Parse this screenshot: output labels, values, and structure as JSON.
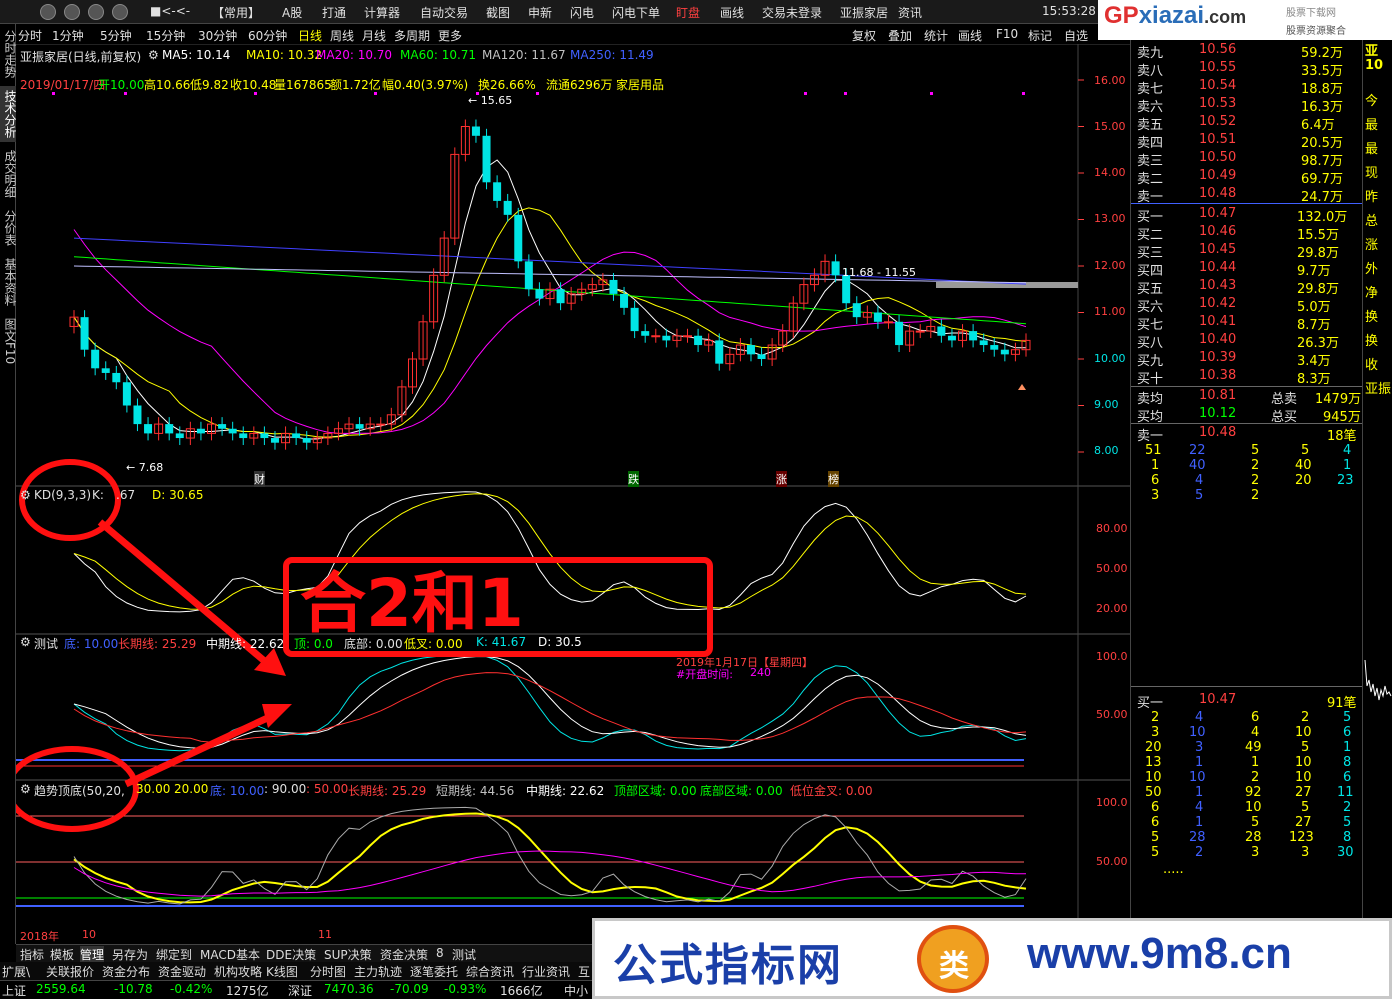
{
  "topbar": {
    "menus": [
      "【常用】",
      "A股",
      "打通",
      "计算器",
      "自动交易",
      "截图",
      "申新",
      "闪电",
      "闪电下单",
      "盯盘",
      "画线",
      "交易未登录",
      "亚振家居",
      "资讯"
    ],
    "time": "15:53:28"
  },
  "logo": {
    "gp": "GP",
    "rest": "xiazai",
    "dot": ".com",
    "sub1": "股票下载网",
    "sub2": "股票资源聚合"
  },
  "sidebar": [
    "分时走势",
    "技术分析",
    "成交明细",
    "分价表",
    "基本资料",
    "图文F10"
  ],
  "periods": [
    "分时",
    "1分钟",
    "5分钟",
    "15分钟",
    "30分钟",
    "60分钟",
    "日线",
    "周线",
    "月线",
    "多周期",
    "更多"
  ],
  "tools": [
    "复权",
    "叠加",
    "统计",
    "画线",
    "F10",
    "标记",
    "自选"
  ],
  "stock": {
    "name": "亚振家居(日线,前复权)",
    "ma5": "MA5: 10.14",
    "ma10": "MA10: 10.32",
    "ma20": "MA20: 10.70",
    "ma60": "MA60: 10.71",
    "ma120": "MA120: 11.67",
    "ma250": "MA250: 11.49"
  },
  "info": {
    "date": "2019/01/17/四",
    "open": "开10.00",
    "high": "高10.66",
    "low": "低9.82",
    "close": "收10.48",
    "vol": "量167865",
    "amt": "额1.72亿",
    "chg": "幅0.40(3.97%)",
    "turn": "换26.66%",
    "float": "流通6296万",
    "industry": "家居用品"
  },
  "annot": {
    "hi": "15.65",
    "lo": "7.68",
    "band": "11.68 - 11.55",
    "cai": "财",
    "die": "跌",
    "zhang": "涨",
    "bang": "榜"
  },
  "y_price": [
    "16.00",
    "15.00",
    "14.00",
    "13.00",
    "12.00",
    "11.00",
    "10.00",
    "9.00",
    "8.00"
  ],
  "kd": {
    "title": "KD(9,3,3)",
    "k": "K:",
    "kv": ".67",
    "d": "D: 30.65",
    "ticks": [
      "80.00",
      "50.00",
      "20.00"
    ]
  },
  "test": {
    "title": "测试",
    "di": "底: 10.00",
    "chang": "长期线: 25.29",
    "zhong": "中期线: 22.62",
    "ding": "顶: 0.0",
    "dibu": "底部: 0.00",
    "dicha": "低叉: 0.00",
    "k": "K: 41.67",
    "d": "D: 30.5",
    "ticks": [
      "100.0",
      "50.00"
    ],
    "datelbl": "2019年1月17日【星期四】",
    "opentime": "#开盘时间:",
    "openval": "240"
  },
  "trend": {
    "title": "趋势顶底(50,20,",
    "p2": "30.00",
    "p3": "20.00",
    "di": "底: 10.00",
    "p90": ": 90.00",
    "p50": ": 50.00",
    "chang": "长期线: 25.29",
    "duan": "短期线: 44.56",
    "zhong": "中期线: 22.62",
    "dingqu": "顶部区域: 0.00",
    "diqu": "底部区域: 0.00",
    "jincha": "低位金叉: 0.00",
    "ticks": [
      "100.0",
      "50.00"
    ]
  },
  "xaxis": {
    "y2018": "2018年",
    "m10": "10",
    "m11": "11"
  },
  "overlay": {
    "text": "合2和1"
  },
  "orderbook": {
    "sell": [
      [
        "卖九",
        "10.56",
        "59.2万"
      ],
      [
        "卖八",
        "10.55",
        "33.5万"
      ],
      [
        "卖七",
        "10.54",
        "18.8万"
      ],
      [
        "卖六",
        "10.53",
        "16.3万"
      ],
      [
        "卖五",
        "10.52",
        "6.4万"
      ],
      [
        "卖四",
        "10.51",
        "20.5万"
      ],
      [
        "卖三",
        "10.50",
        "98.7万"
      ],
      [
        "卖二",
        "10.49",
        "69.7万"
      ],
      [
        "卖一",
        "10.48",
        "24.7万"
      ]
    ],
    "buy": [
      [
        "买一",
        "10.47",
        "132.0万"
      ],
      [
        "买二",
        "10.46",
        "15.5万"
      ],
      [
        "买三",
        "10.45",
        "29.8万"
      ],
      [
        "买四",
        "10.44",
        "9.7万"
      ],
      [
        "买五",
        "10.43",
        "29.8万"
      ],
      [
        "买六",
        "10.42",
        "5.0万"
      ],
      [
        "买七",
        "10.41",
        "8.7万"
      ],
      [
        "买八",
        "10.40",
        "26.3万"
      ],
      [
        "买九",
        "10.39",
        "3.4万"
      ],
      [
        "买十",
        "10.38",
        "8.3万"
      ]
    ],
    "avg_sell": [
      "卖均",
      "10.81",
      "总卖",
      "1479万"
    ],
    "avg_buy": [
      "买均",
      "10.12",
      "总买",
      "945万"
    ],
    "sell1_line": [
      "卖一",
      "10.48",
      "18笔"
    ],
    "sell1_rows": [
      [
        "51",
        "22",
        "5",
        "5",
        "4"
      ],
      [
        "1",
        "40",
        "2",
        "40",
        "1"
      ],
      [
        "6",
        "4",
        "2",
        "20",
        "23"
      ],
      [
        "3",
        "5",
        "2",
        "",
        ""
      ]
    ],
    "buy1_line": [
      "买一",
      "10.47",
      "91笔"
    ],
    "buy1_rows": [
      [
        "2",
        "4",
        "6",
        "2",
        "5"
      ],
      [
        "3",
        "10",
        "4",
        "10",
        "6"
      ],
      [
        "20",
        "3",
        "49",
        "5",
        "1"
      ],
      [
        "13",
        "1",
        "1",
        "10",
        "8"
      ],
      [
        "10",
        "10",
        "2",
        "10",
        "6"
      ],
      [
        "50",
        "1",
        "92",
        "27",
        "11"
      ],
      [
        "6",
        "4",
        "10",
        "5",
        "2"
      ],
      [
        "6",
        "1",
        "5",
        "27",
        "5"
      ],
      [
        "5",
        "28",
        "28",
        "123",
        "8"
      ],
      [
        "5",
        "2",
        "3",
        "3",
        "30"
      ]
    ],
    "dots": "....."
  },
  "farright": [
    "今",
    "最",
    "最",
    "现",
    "昨",
    "总",
    "涨",
    "外",
    "净",
    "换",
    "换",
    "收",
    "亚振"
  ],
  "farright_top": [
    "亚",
    "10"
  ],
  "bottomtabs": [
    "指标",
    "模板",
    "管理",
    "另存为",
    "绑定到",
    "MACD基本",
    "DDE决策",
    "SUP决策",
    "资金决策",
    "8",
    "测试"
  ],
  "bottomlinks": [
    "扩展\\",
    "关联报价",
    "资金分布",
    "资金驱动",
    "机构攻略",
    "K线图",
    "分时图",
    "主力轨迹",
    "逐笔委托",
    "综合资讯",
    "行业资讯",
    "互"
  ],
  "status": {
    "sh": "上证",
    "sh_v": "2559.64",
    "sh_c": "-10.78",
    "sh_p": "-0.42%",
    "sh_a": "1275亿",
    "sz": "深证",
    "sz_v": "7470.36",
    "sz_c": "-70.09",
    "sz_p": "-0.93%",
    "sz_a": "1666亿",
    "zx": "中小"
  },
  "watermark": {
    "t1": "公式指标网",
    "t2": "www.9m8.cn",
    "coin": "类"
  },
  "colors": {
    "up": "#ff3030",
    "down": "#00e5e5",
    "ma5": "#ffffff",
    "ma10": "#ffff00",
    "ma20": "#ff00ff",
    "ma60": "#00ff00",
    "ma120": "#4040ff",
    "ma250": "#00c0ff",
    "red_overlay": "#ff1010"
  }
}
